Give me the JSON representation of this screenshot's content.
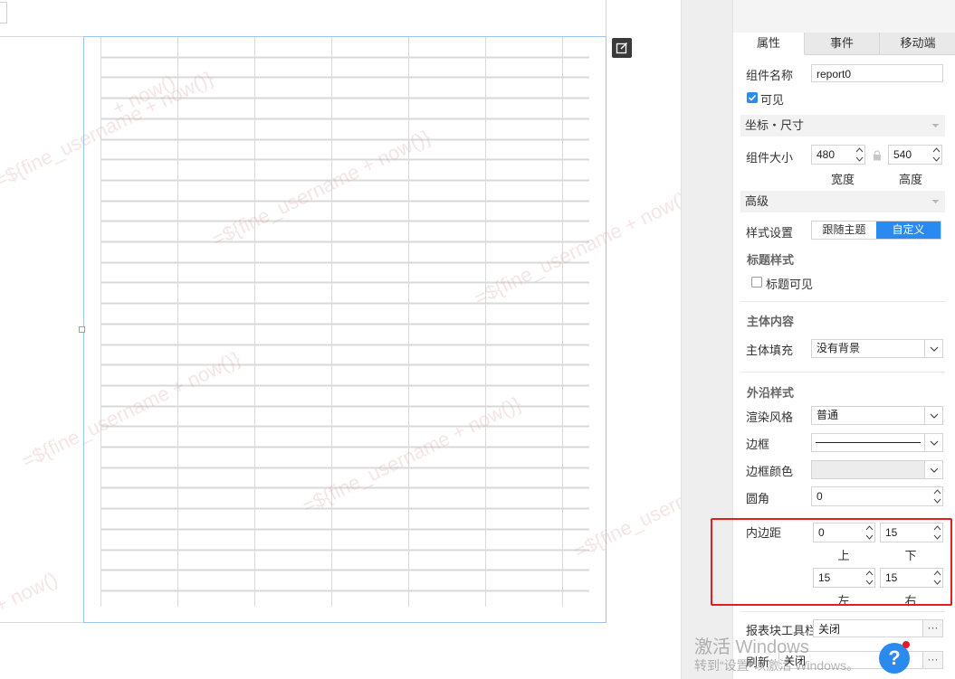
{
  "canvas": {
    "watermark_text": "=${fine_username + now()}",
    "watermark_fragment": "+ now()",
    "table": {
      "columns": 7,
      "rows": 28
    }
  },
  "panel": {
    "tabs": [
      {
        "label": "属性",
        "active": true
      },
      {
        "label": "事件",
        "active": false
      },
      {
        "label": "移动端",
        "active": false
      }
    ],
    "widget_name": {
      "label": "组件名称",
      "value": "report0"
    },
    "visible": {
      "label": "可见",
      "checked": true
    },
    "coords_section": "坐标・尺寸",
    "size": {
      "label": "组件大小",
      "width": "480",
      "height": "540",
      "width_label": "宽度",
      "height_label": "高度"
    },
    "advanced_section": "高级",
    "style": {
      "label": "样式设置",
      "options": [
        "跟随主题",
        "自定义"
      ],
      "selected": "自定义"
    },
    "title_style": {
      "title": "标题样式",
      "title_visible_label": "标题可见",
      "title_visible_checked": false
    },
    "body": {
      "title": "主体内容",
      "fill_label": "主体填充",
      "fill_value": "没有背景"
    },
    "outer": {
      "title": "外沿样式",
      "render_label": "渲染风格",
      "render_value": "普通",
      "border_label": "边框",
      "border_color_label": "边框颜色",
      "radius_label": "圆角",
      "radius_value": "0"
    },
    "padding": {
      "label": "内边距",
      "top": "0",
      "bottom": "15",
      "left": "15",
      "right": "15",
      "top_label": "上",
      "bottom_label": "下",
      "left_label": "左",
      "right_label": "右"
    },
    "toolbar": {
      "label": "报表块工具栏",
      "value": "关闭",
      "more": "···"
    },
    "refresh": {
      "label": "刷新",
      "value": "关闭",
      "more": "···"
    }
  },
  "os": {
    "activate_line1": "激活 Windows",
    "activate_line2": "转到“设置”以激活 Windows。"
  },
  "help": {
    "label": "?"
  },
  "colors": {
    "accent": "#2b8af0",
    "highlight": "#e02020",
    "selection_border": "#9cc4ee",
    "grid_line": "#d9d9d9"
  }
}
